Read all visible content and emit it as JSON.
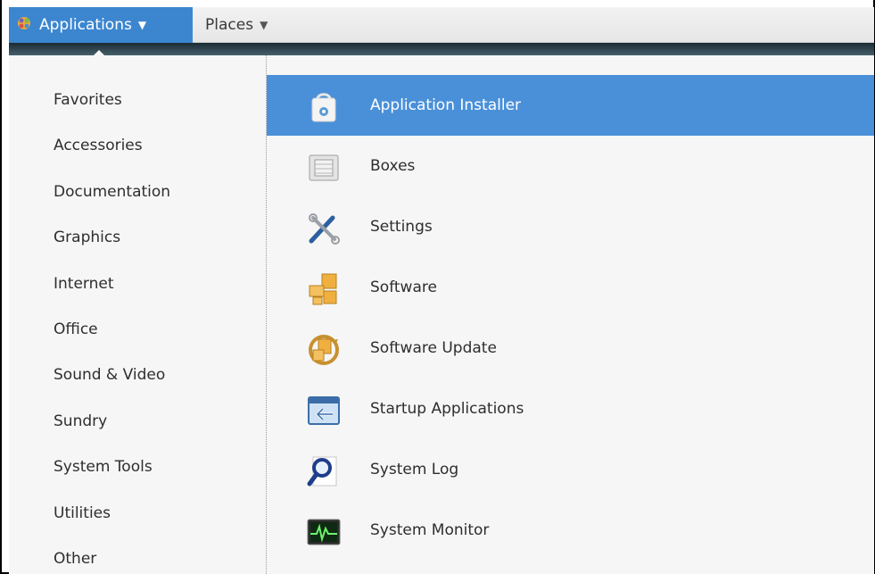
{
  "panel": {
    "applications_label": "Applications",
    "places_label": "Places",
    "caret": "▼"
  },
  "categories": [
    "Favorites",
    "Accessories",
    "Documentation",
    "Graphics",
    "Internet",
    "Office",
    "Sound & Video",
    "Sundry",
    "System Tools",
    "Utilities",
    "Other"
  ],
  "apps": [
    {
      "label": "Application Installer",
      "icon": "shopping-bag-icon",
      "selected": true
    },
    {
      "label": "Boxes",
      "icon": "boxes-icon",
      "selected": false
    },
    {
      "label": "Settings",
      "icon": "tools-icon",
      "selected": false
    },
    {
      "label": "Software",
      "icon": "packages-icon",
      "selected": false
    },
    {
      "label": "Software Update",
      "icon": "update-icon",
      "selected": false
    },
    {
      "label": "Startup Applications",
      "icon": "startup-icon",
      "selected": false
    },
    {
      "label": "System Log",
      "icon": "magnifier-icon",
      "selected": false
    },
    {
      "label": "System Monitor",
      "icon": "monitor-icon",
      "selected": false
    }
  ],
  "colors": {
    "accent": "#3c86d0",
    "selection": "#4a90d9"
  }
}
